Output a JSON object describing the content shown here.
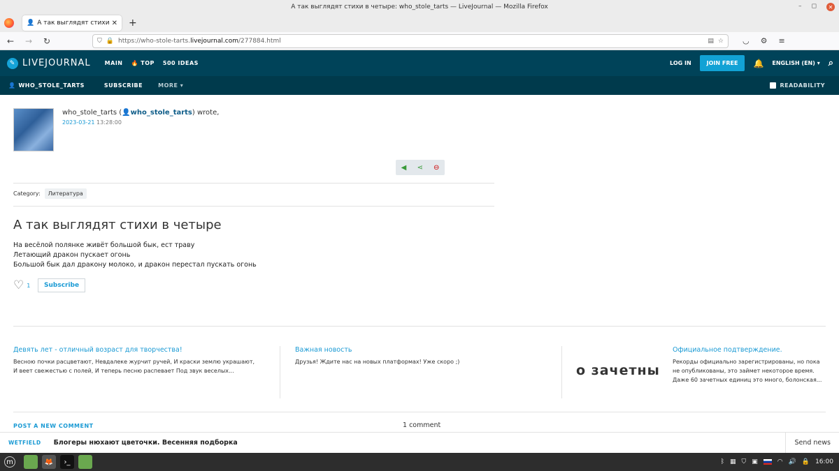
{
  "window": {
    "title": "А так выглядят стихи в четыре: who_stole_tarts — LiveJournal — Mozilla Firefox"
  },
  "browser": {
    "tab_title": "А так выглядят стихи в чет",
    "url_prefix": "https://who-stole-tarts.",
    "url_domain": "livejournal.com",
    "url_path": "/277884.html"
  },
  "lj_header": {
    "logo": "LIVEJOURNAL",
    "nav": [
      "MAIN",
      "TOP",
      "500 IDEAS"
    ],
    "login": "LOG IN",
    "join": "JOIN FREE",
    "language": "ENGLISH (EN)"
  },
  "subheader": {
    "user": "WHO_STOLE_TARTS",
    "subscribe": "SUBSCRIBE",
    "more": "MORE",
    "readability": "READABILITY"
  },
  "post": {
    "author_name": "who_stole_tarts",
    "author_link": "who_stole_tarts",
    "wrote": "wrote,",
    "date": "2023-03-21",
    "time": "13:28:00",
    "category_label": "Category:",
    "category": "Литература",
    "title": "А так выглядят стихи в четыре",
    "lines": [
      "На весёлой полянке живёт большой бык, ест траву",
      "Летающий дракон пускает огонь",
      "Большой бык дал дракону молоко, и дракон перестал пускать огонь"
    ],
    "likes": "1",
    "subscribe_label": "Subscribe"
  },
  "related": [
    {
      "title": "Девять лет - отличный возраст для творчества!",
      "text_lines": [
        "Весною почки расцветают, Невдалеке журчит ручей, И краски землю украшают,",
        "И веет свежестью с полей, И теперь песню распевает Под звук веселых..."
      ]
    },
    {
      "title": "Важная новость",
      "text_lines": [
        "Друзья! Ждите нас на новых платформах! Уже скоро ;)"
      ]
    },
    {
      "title": "Официальное подтверждение.",
      "image_text": "о зачетны",
      "text_lines": [
        "Рекорды официально зарегистрированы, но пока",
        "не опубликованы, это займет некоторое время.",
        "Даже 60 зачетных единиц это много, болонская..."
      ]
    }
  ],
  "comments": {
    "post_label": "POST A NEW COMMENT",
    "count": "1 comment"
  },
  "sticky": {
    "source": "WETFIELD",
    "headline": "Блогеры нюхают цветочки. Весенняя подборка",
    "send": "Send news"
  },
  "taskbar": {
    "clock": "16:00"
  }
}
